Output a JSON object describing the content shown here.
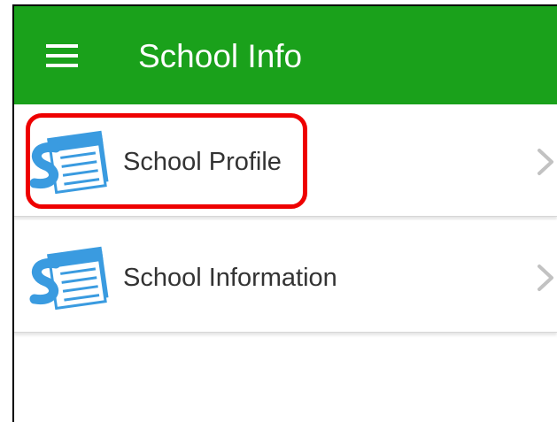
{
  "appbar": {
    "title": "School Info",
    "menu_icon": "hamburger-menu-icon",
    "background_color": "#1aa11b"
  },
  "list": {
    "items": [
      {
        "label": "School Profile",
        "icon": "school-notebook-icon",
        "trailing_icon": "chevron-right-icon",
        "highlighted": true
      },
      {
        "label": "School Information",
        "icon": "school-notebook-icon",
        "trailing_icon": "chevron-right-icon",
        "highlighted": false
      }
    ]
  },
  "colors": {
    "icon_blue": "#3a9be0",
    "highlight_red": "#ee0000",
    "chevron_gray": "#c2c2c2"
  }
}
